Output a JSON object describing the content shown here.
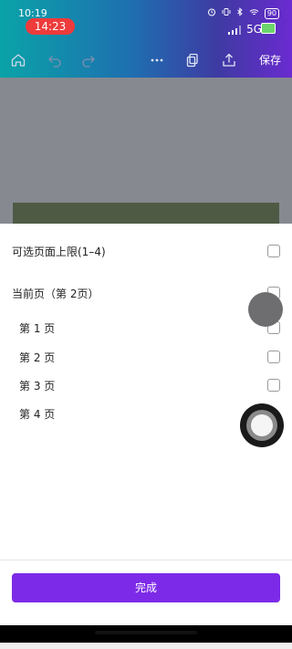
{
  "status_bar": {
    "time": "10:19",
    "call_timer": "14:23",
    "network": "5G",
    "battery_level": "90"
  },
  "toolbar": {
    "save_label": "保存"
  },
  "sheet": {
    "rows": [
      {
        "label": "可选页面上限(1–4)"
      },
      {
        "label": "当前页（第 2页）"
      },
      {
        "label": "第 1 页"
      },
      {
        "label": "第 2 页"
      },
      {
        "label": "第 3 页"
      },
      {
        "label": "第 4 页"
      }
    ],
    "done_label": "完成"
  },
  "colors": {
    "accent": "#7d2ae8",
    "call_pill": "#ee3b3b"
  }
}
